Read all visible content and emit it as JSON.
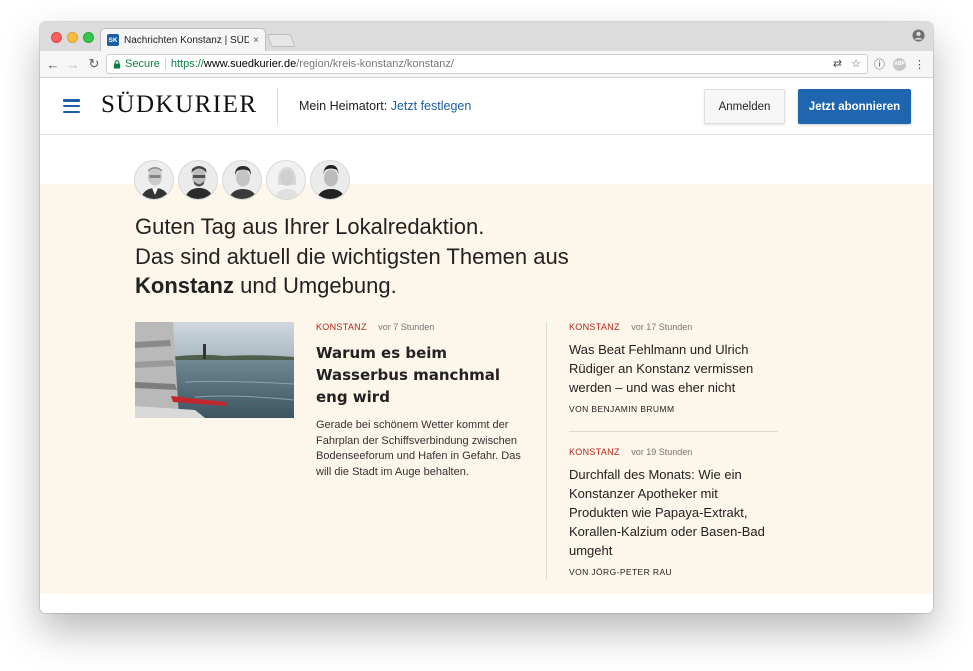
{
  "browser": {
    "tab_title": "Nachrichten Konstanz | SÜDKURIER",
    "tab_favicon": "SK",
    "tab_close": "×",
    "secure_label": "Secure",
    "url_scheme": "https://",
    "url_host": "www.suedkurier.de",
    "url_path": "/region/kreis-konstanz/konstanz/",
    "icons": [
      "back-arrow-icon",
      "forward-arrow-icon",
      "reload-icon",
      "lock-icon",
      "translate-icon",
      "star-icon",
      "info-icon",
      "adblock-icon",
      "menu-dots-icon",
      "profile-icon"
    ]
  },
  "header": {
    "logo": "SÜDKURIER",
    "heimatort_label": "Mein Heimatort:",
    "heimatort_link": "Jetzt festlegen",
    "login_label": "Anmelden",
    "subscribe_label": "Jetzt abonnieren"
  },
  "greeting": {
    "line1": "Guten Tag aus Ihrer Lokalredaktion.",
    "line2": "Das sind aktuell die wichtigsten Themen aus",
    "city": "Konstanz",
    "line3_rest": "und Umgebung."
  },
  "lead_article": {
    "category": "KONSTANZ",
    "time": "vor 7 Stunden",
    "title": "Warum es beim Wasserbus manchmal eng wird",
    "teaser": "Gerade bei schönem Wetter kommt der Fahrplan der Schiffsverbindung zwischen Bodenseeforum und Hafen in Gefahr. Das will die Stadt im Auge behalten."
  },
  "side_articles": [
    {
      "category": "KONSTANZ",
      "time": "vor 17 Stunden",
      "title": "Was Beat Fehlmann und Ulrich Rüdiger an Konstanz vermissen werden – und was eher nicht",
      "author": "VON BENJAMIN BRUMM"
    },
    {
      "category": "KONSTANZ",
      "time": "vor 19 Stunden",
      "title": "Durchfall des Monats: Wie ein Konstanzer Apotheker mit Produkten wie Papaya-Extrakt, Korallen-Kalzium oder Basen-Bad umgeht",
      "author": "VON JÖRG-PETER RAU"
    }
  ],
  "colors": {
    "brand_blue": "#1e66b0",
    "category_red": "#b3261e",
    "beige_background": "#fdf6ea"
  }
}
